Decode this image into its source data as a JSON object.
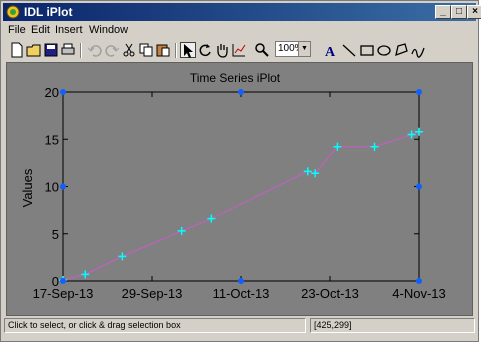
{
  "window": {
    "title": "IDL iPlot"
  },
  "menu": [
    "File",
    "Edit",
    "Insert",
    "Window"
  ],
  "toolbar": {
    "zoom_value": "100%"
  },
  "status": {
    "hint": "Click to select, or click & drag selection box",
    "coords": "[425,299]"
  },
  "colors": {
    "canvas": "#808080",
    "line": "#c060c0",
    "marker": "#00ffff",
    "handle": "#1060ff"
  },
  "chart_data": {
    "type": "line",
    "title": "Time Series iPlot",
    "xlabel": "",
    "ylabel": "Values",
    "x_ticks": [
      "17-Sep-13",
      "29-Sep-13",
      "11-Oct-13",
      "23-Oct-13",
      "4-Nov-13"
    ],
    "y_ticks": [
      0,
      5,
      10,
      15,
      20
    ],
    "ylim": [
      0,
      20
    ],
    "xlim": [
      "2013-09-17",
      "2013-11-04"
    ],
    "series": [
      {
        "x": [
          "2013-09-17",
          "2013-09-20",
          "2013-09-25",
          "2013-10-03",
          "2013-10-07",
          "2013-10-20",
          "2013-10-21",
          "2013-10-24",
          "2013-10-29",
          "2013-11-03",
          "2013-11-04"
        ],
        "y": [
          0.1,
          0.7,
          2.6,
          5.3,
          6.6,
          11.6,
          11.4,
          14.2,
          14.2,
          15.5,
          15.8
        ]
      }
    ]
  }
}
